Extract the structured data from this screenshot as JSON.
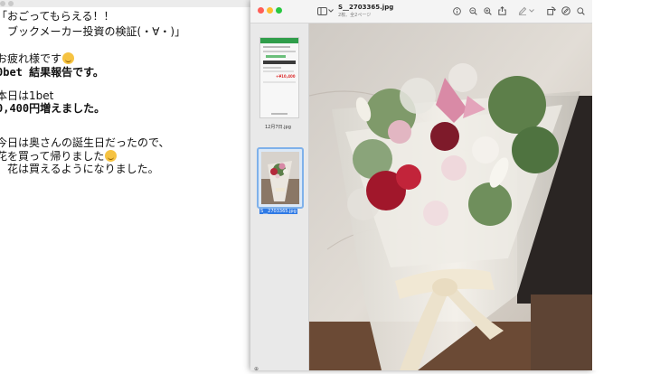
{
  "editor": {
    "lines": [
      "「おごってもらえる！！",
      "　ブックメーカー投資の検証(・∀・)」",
      "",
      "お疲れ様です",
      "0bet 結果報告です。",
      "",
      "本日は1bet",
      "0,400円増えました。",
      "",
      "",
      "今日は奥さんの誕生日だったので、",
      "花を買って帰りました",
      "、花は買えるようになりました。"
    ]
  },
  "preview": {
    "title": "S__2703365.jpg",
    "subtitle": "2枚、全2ページ",
    "thumbnails": [
      {
        "label": "12月7日.jpg",
        "selected": false
      },
      {
        "label": "S__2703365.jpg",
        "selected": true
      }
    ],
    "toolbar_icons": [
      "sidebar-toggle-icon",
      "chevron-down-icon",
      "info-icon",
      "zoom-out-icon",
      "zoom-in-icon",
      "share-icon",
      "markup-pen-icon",
      "chevron-down-icon",
      "rotate-icon",
      "markup-icon",
      "search-icon"
    ],
    "thumb1_amount": "+¥10,400"
  },
  "colors": {
    "close": "#ff5f57",
    "minimize": "#febc2e",
    "zoom": "#28c840",
    "selection": "#2f7ae5",
    "thumb_green": "#2f9d4a"
  }
}
